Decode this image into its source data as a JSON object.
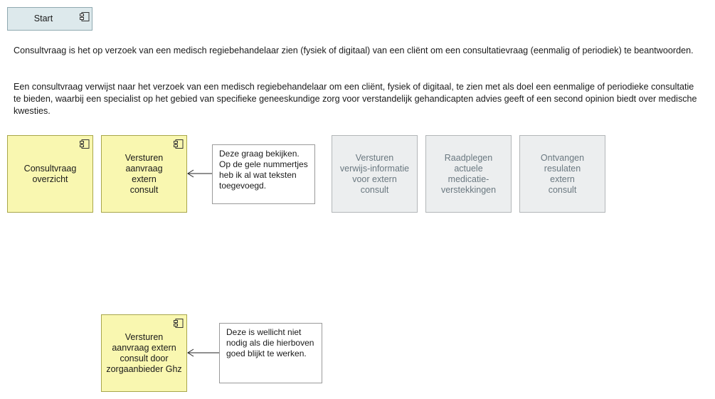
{
  "start_button": {
    "label": "Start"
  },
  "description": {
    "paragraph_1": "Consultvraag is het op verzoek van een medisch regiebehandelaar zien (fysiek of digitaal) van een cliënt om een consultatievraag (eenmalig of periodiek) te beantwoorden.",
    "paragraph_2": "Een consultvraag verwijst naar het verzoek van een medisch regiebehandelaar om een cliënt, fysiek of digitaal, te zien met als doel een eenmalige of periodieke consultatie te bieden, waarbij een specialist op het gebied van specifieke geneeskundige zorg voor verstandelijk gehandicapten advies geeft of een second opinion biedt over medische kwesties."
  },
  "components": {
    "consultvraag_overzicht": "Consultvraag overzicht",
    "versturen_aanvraag": "Versturen aanvraag extern consult",
    "versturen_verwijsinformatie": "Versturen verwijs-informatie voor extern consult",
    "raadplegen_medicatie": "Raadplegen actuele medicatie-verstekkingen",
    "ontvangen_resultaten": "Ontvangen resulaten extern consult",
    "versturen_aanvraag_ghz": "Versturen aanvraag extern consult door zorgaanbieder Ghz"
  },
  "notes": {
    "note_1": "Deze graag bekijken. Op de gele nummertjes heb ik al wat teksten toegevoegd.",
    "note_2": "Deze is wellicht niet nodig als die hierboven goed blijkt te werken."
  },
  "colors": {
    "application_component_active": "#f9f7b0",
    "application_component_inactive": "#eceeef",
    "start_button": "#dde9ec"
  },
  "icons": {
    "component": "application-component-icon"
  }
}
